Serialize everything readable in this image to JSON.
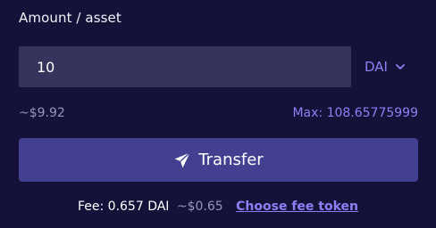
{
  "form": {
    "section_label": "Amount / asset",
    "amount_value": "10",
    "asset": {
      "selected": "DAI",
      "icon": "chevron-down-icon"
    },
    "usd_estimate": "~$9.92",
    "max_label": "Max: 108.65775999"
  },
  "transfer_button": {
    "label": "Transfer",
    "icon": "paper-plane-icon"
  },
  "fee": {
    "text": "Fee: 0.657 DAI",
    "usd": "~$0.65",
    "choose_token_link": "Choose fee token"
  },
  "colors": {
    "background": "#141238",
    "input_background": "#35345c",
    "accent": "#8c80f6",
    "button": "#433f91",
    "muted_text": "#9795b8"
  }
}
